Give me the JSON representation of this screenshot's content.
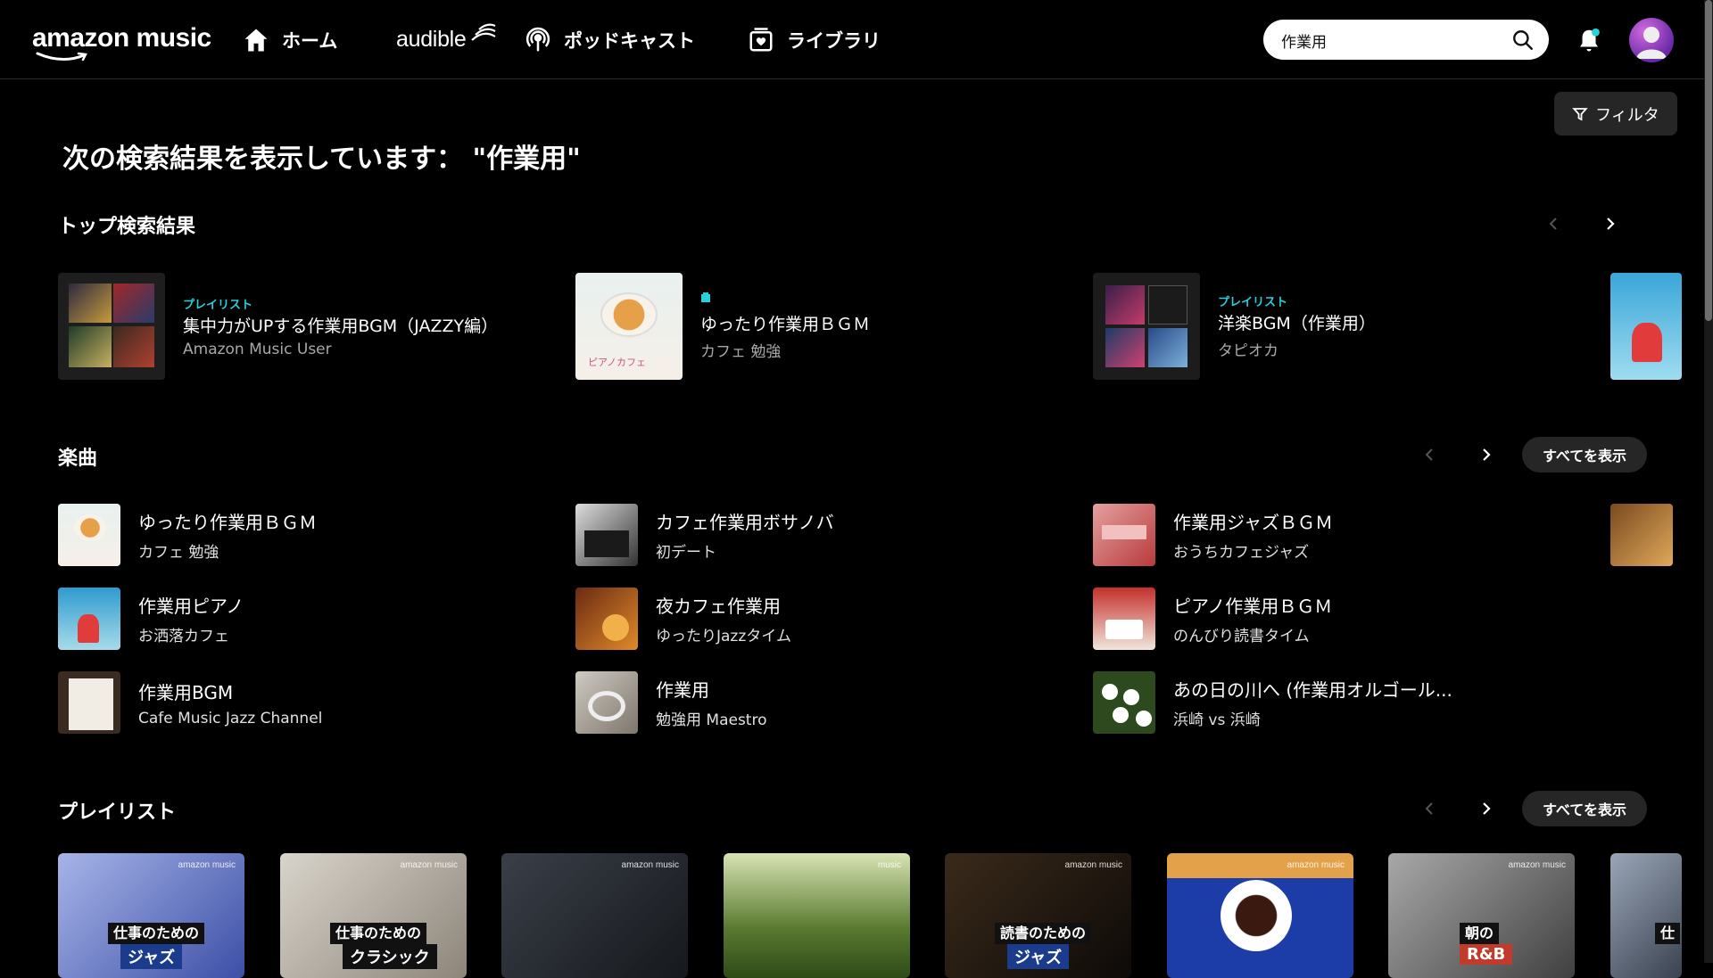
{
  "header": {
    "logo": "amazon music",
    "nav": [
      {
        "label": "ホーム"
      },
      {
        "label": "audible"
      },
      {
        "label": "ポッドキャスト"
      },
      {
        "label": "ライブラリ"
      }
    ],
    "search_value": "作業用"
  },
  "filter_label": "フィルタ",
  "page_title": "次の検索結果を表示しています： \"作業用\"",
  "top_results": {
    "title": "トップ検索結果",
    "items": [
      {
        "type": "プレイリスト",
        "title": "集中力がUPする作業用BGM（JAZZY編）",
        "sub": "Amazon Music User"
      },
      {
        "type": "",
        "title": "ゆったり作業用ＢＧＭ",
        "sub": "カフェ 勉強"
      },
      {
        "type": "プレイリスト",
        "title": "洋楽BGM（作業用）",
        "sub": "タピオカ"
      }
    ]
  },
  "songs": {
    "title": "楽曲",
    "show_all": "すべてを表示",
    "items": [
      {
        "title": "ゆったり作業用ＢＧＭ",
        "sub": "カフェ 勉強"
      },
      {
        "title": "作業用ピアノ",
        "sub": "お洒落カフェ"
      },
      {
        "title": "作業用BGM",
        "sub": "Cafe Music Jazz Channel"
      },
      {
        "title": "カフェ作業用ボサノバ",
        "sub": "初デート"
      },
      {
        "title": "夜カフェ作業用",
        "sub": "ゆったりJazzタイム"
      },
      {
        "title": "作業用",
        "sub": "勉強用 Maestro"
      },
      {
        "title": "作業用ジャズＢＧＭ",
        "sub": "おうちカフェジャズ"
      },
      {
        "title": "ピアノ作業用ＢＧＭ",
        "sub": "のんびり読書タイム"
      },
      {
        "title": "あの日の川へ (作業用オルゴール...",
        "sub": "浜崎 vs 浜崎"
      }
    ]
  },
  "playlists": {
    "title": "プレイリスト",
    "show_all": "すべてを表示",
    "items": [
      {
        "label": "仕事のための",
        "label2": "ジャズ"
      },
      {
        "label": "仕事のための",
        "label2": "クラシック"
      },
      {
        "label": "",
        "label2": ""
      },
      {
        "label": "",
        "label2": ""
      },
      {
        "label": "読書のための",
        "label2": "ジャズ"
      },
      {
        "label": "",
        "label2": ""
      },
      {
        "label": "朝の",
        "label2": "R&B"
      },
      {
        "label": "仕",
        "label2": ""
      }
    ],
    "brand": "amazon music"
  },
  "colors": {
    "accent": "#25d1da",
    "background": "#000000",
    "button_bg": "#262626"
  }
}
